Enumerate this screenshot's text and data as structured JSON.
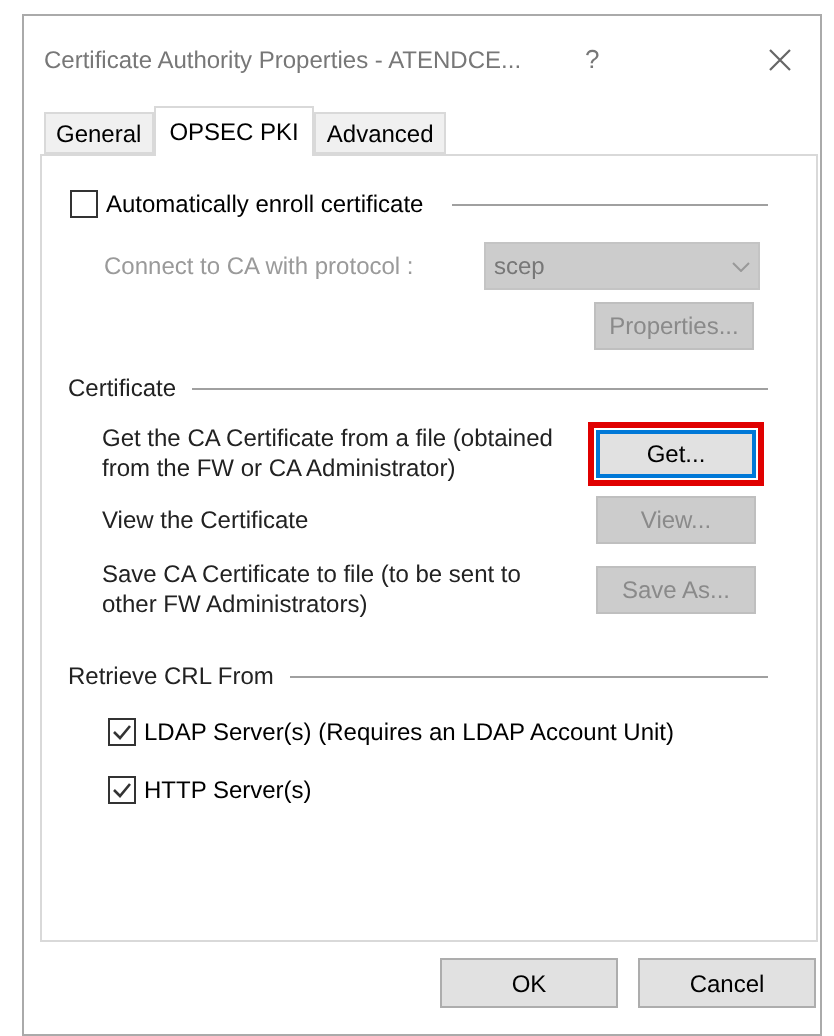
{
  "window": {
    "title": "Certificate Authority Properties - ATENDCE...",
    "help": "?"
  },
  "tabs": [
    {
      "label": "General",
      "selected": false
    },
    {
      "label": "OPSEC PKI",
      "selected": true
    },
    {
      "label": "Advanced",
      "selected": false
    }
  ],
  "auto_enroll": {
    "label": "Automatically enroll certificate",
    "checked": false
  },
  "protocol": {
    "label": "Connect to CA with protocol :",
    "value": "scep",
    "disabled": true
  },
  "properties_button": {
    "label": "Properties...",
    "disabled": true
  },
  "certificate": {
    "title": "Certificate",
    "rows": [
      {
        "text": "Get the CA Certificate from a file (obtained from the FW or CA Administrator)",
        "button": {
          "label": "Get...",
          "disabled": false,
          "highlighted": true
        }
      },
      {
        "text": "View the Certificate",
        "button": {
          "label": "View...",
          "disabled": true,
          "highlighted": false
        }
      },
      {
        "text": "Save CA Certificate to file (to be sent to other FW Administrators)",
        "button": {
          "label": "Save As...",
          "disabled": true,
          "highlighted": false
        }
      }
    ]
  },
  "crl": {
    "title": "Retrieve CRL From",
    "options": [
      {
        "label": "LDAP Server(s) (Requires an LDAP Account Unit)",
        "checked": true
      },
      {
        "label": "HTTP Server(s)",
        "checked": true
      }
    ]
  },
  "buttons": [
    {
      "label": "OK"
    },
    {
      "label": "Cancel"
    }
  ]
}
